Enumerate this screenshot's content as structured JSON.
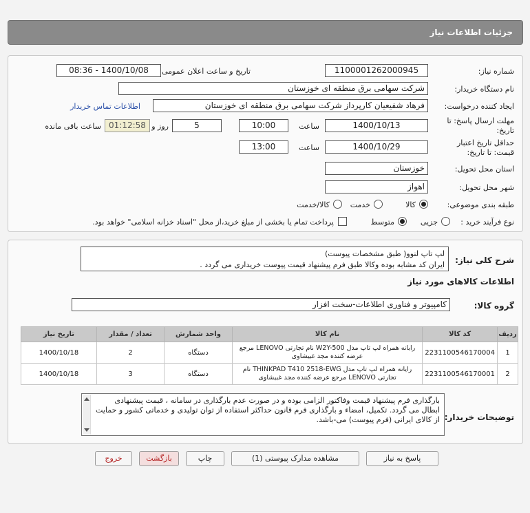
{
  "page": {
    "title": "جزئیات اطلاعات نیاز"
  },
  "fields": {
    "need_number_label": "شماره نیاز:",
    "need_number": "1100001262000945",
    "announce_label": "تاریخ و ساعت اعلان عمومی:",
    "announce_value": "1400/10/08 - 08:36",
    "buyer_org_label": "نام دستگاه خریدار:",
    "buyer_org": "شرکت سهامی برق منطقه ای خوزستان",
    "creator_label": "ایجاد کننده درخواست:",
    "creator": "فرهاد شفیعیان کارپرداز شرکت سهامی برق منطقه ای خوزستان",
    "contact_link": "اطلاعات تماس خریدار",
    "deadline_label_1": "مهلت ارسال پاسخ: تا",
    "deadline_label_2": "تاریخ:",
    "deadline_date": "1400/10/13",
    "time_label": "ساعت",
    "deadline_time": "10:00",
    "days_value": "5",
    "days_label": "روز و",
    "remaining_time": "01:12:58",
    "remaining_label": "ساعت باقی مانده",
    "validity_label_1": "حداقل تاریخ اعتبار",
    "validity_label_2": "قیمت: تا تاریخ:",
    "validity_date": "1400/10/29",
    "validity_time_label": "ساعت",
    "validity_time": "13:00",
    "province_label": "استان محل تحویل:",
    "province": "خوزستان",
    "city_label": "شهر محل تحویل:",
    "city": "اهواز",
    "category_label": "طبقه بندی موضوعی:",
    "category_options": [
      "کالا",
      "خدمت",
      "کالا/خدمت"
    ],
    "process_label": "نوع فرآیند خرید :",
    "process_options": [
      "جزیی",
      "متوسط"
    ],
    "payment_note": "پرداخت تمام یا بخشی از مبلغ خرید،از محل \"اسناد خزانه اسلامی\" خواهد بود."
  },
  "summary": {
    "label": "شرح کلی نیاز:",
    "line1": "لپ تاپ لنوو( طبق مشخصات پیوست)",
    "line2": "ایران کد مشابه بوده وکالا طبق فرم پیشنهاد قیمت پیوست خریداری می گردد ."
  },
  "goods": {
    "section_title": "اطلاعات کالاهای مورد نیاز",
    "group_label": "گروه کالا:",
    "group_value": "کامپیوتر و فناوری اطلاعات-سخت افزار",
    "headers": [
      "ردیف",
      "کد کالا",
      "نام کالا",
      "واحد شمارش",
      "تعداد / مقدار",
      "تاریخ نیاز"
    ],
    "rows": [
      {
        "index": "1",
        "code": "2231100546170004",
        "name": "رایانه همراه لپ تاپ مدل W2Y-500 نام تجارتی LENOVO مرجع عرضه کننده مجد غبیشاوی",
        "unit": "دستگاه",
        "qty": "2",
        "date": "1400/10/18"
      },
      {
        "index": "2",
        "code": "2231100546170001",
        "name": "رایانه همراه لپ تاپ مدل THINKPAD T410 2518-EWG نام تجارتی LENOVO مرجع عرضه کننده مجد غبیشاوی",
        "unit": "دستگاه",
        "qty": "3",
        "date": "1400/10/18"
      }
    ]
  },
  "notes": {
    "label": "توضیحات خریدار:",
    "text": "بارگذاری فرم پیشنهاد قیمت وفاکتور الزامی بوده و در صورت عدم بارگذاری در سامانه ، قیمت پیشنهادی ابطال می گردد. تکمیل، امضاء و بارگذاری فرم قانون حداکثر استفاده از توان تولیدی و خدماتی کشور و حمایت از کالای ایرانی (فرم پیوست) می-باشد."
  },
  "buttons": {
    "reply": "پاسخ به نیاز",
    "attachments": "مشاهده مدارک پیوستی (1)",
    "print": "چاپ",
    "back": "بازگشت",
    "exit": "خروج"
  },
  "colors": {
    "title_bar": "#8a8a8a",
    "link": "#2a4fa8",
    "timer_bg": "#f2efd0"
  }
}
